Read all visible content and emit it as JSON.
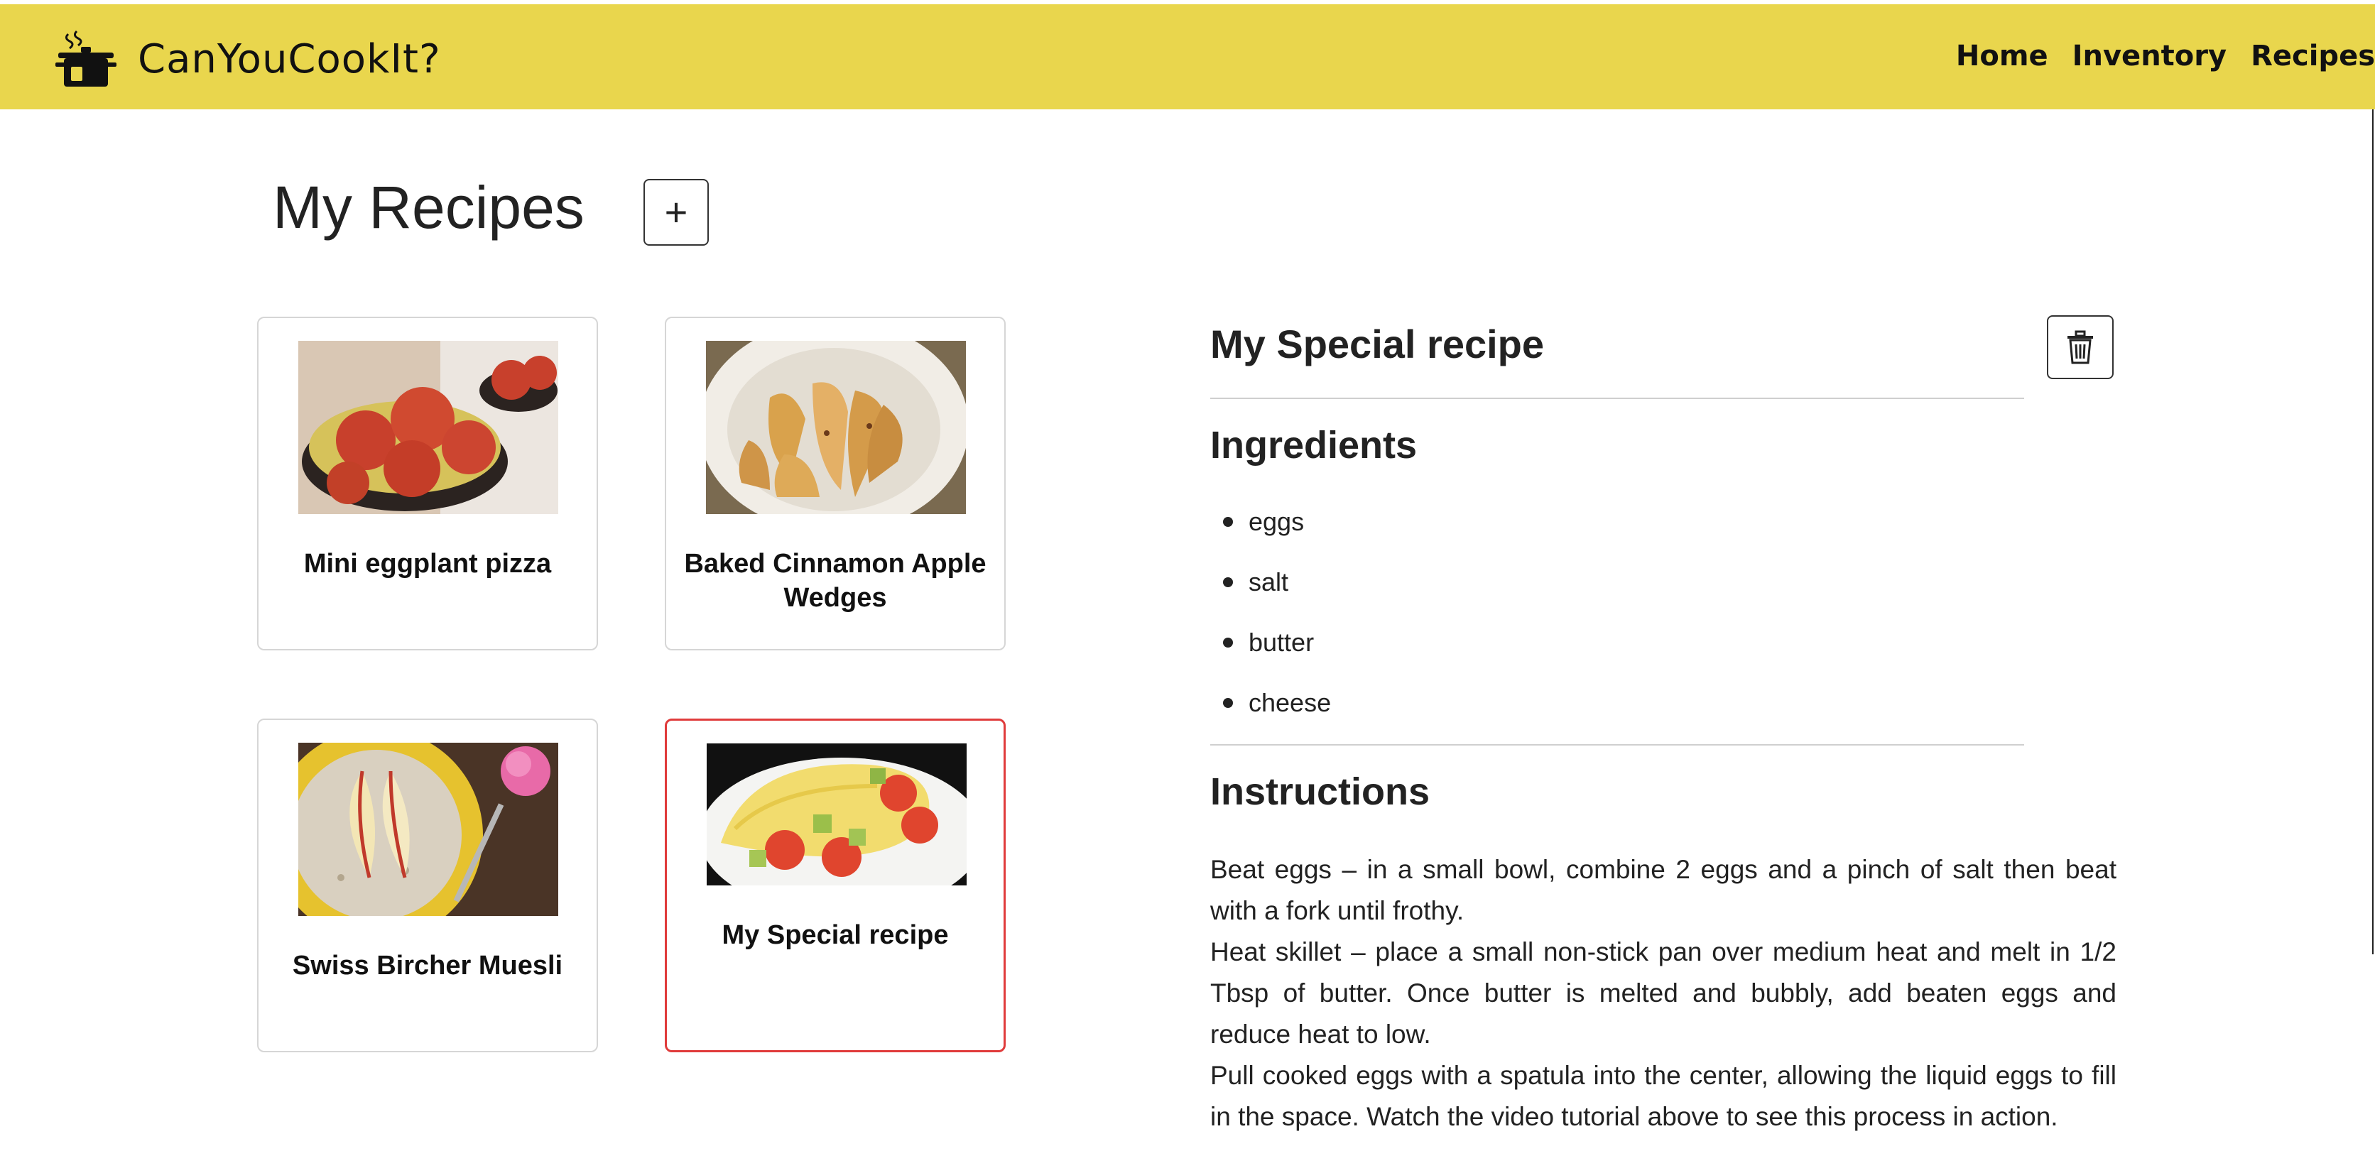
{
  "header": {
    "brand": "CanYouCookIt?",
    "logo_icon": "cooking-pot-icon",
    "nav": [
      "Home",
      "Inventory",
      "Recipes"
    ],
    "bg_color": "#e9d64d"
  },
  "page": {
    "title": "My Recipes",
    "add_label": "+"
  },
  "recipes": [
    {
      "title": "Mini eggplant pizza",
      "image": "eggplant-pizza-photo",
      "selected": false
    },
    {
      "title": "Baked Cinnamon Apple Wedges",
      "image": "apple-wedges-photo",
      "selected": false
    },
    {
      "title": "Swiss Bircher Muesli",
      "image": "muesli-photo",
      "selected": false
    },
    {
      "title": "My Special recipe",
      "image": "omelette-photo",
      "selected": true
    }
  ],
  "detail": {
    "title": "My Special recipe",
    "delete_icon": "trash-icon",
    "ingredients_heading": "Ingredients",
    "ingredients": [
      "eggs",
      "salt",
      "butter",
      "cheese"
    ],
    "instructions_heading": "Instructions",
    "instructions": [
      "Beat eggs – in a small bowl, combine 2 eggs and a pinch of salt then beat with a fork until frothy.",
      "Heat skillet – place a small non-stick pan over medium heat and melt in 1/2 Tbsp of butter. Once butter is melted and bubbly, add beaten eggs and reduce heat to low.",
      "Pull cooked eggs with a spatula into the center, allowing the liquid eggs to fill in the space. Watch the video tutorial above to see this process in action."
    ]
  },
  "colors": {
    "selected_border": "#e03b3b",
    "card_border": "#d6d6d6"
  }
}
